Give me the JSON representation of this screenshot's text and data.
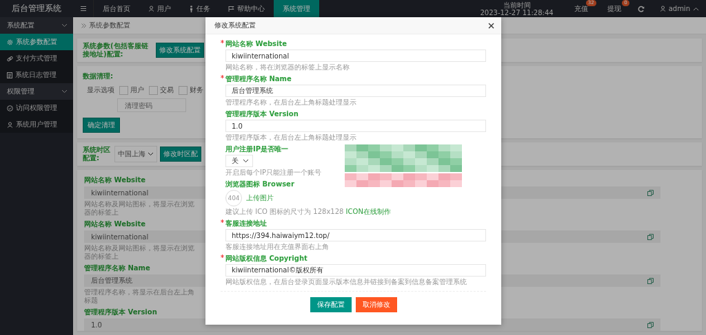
{
  "app_title": "后台管理系统",
  "topnav": [
    {
      "label": "后台首页",
      "selected": false
    },
    {
      "label": "用户",
      "selected": false
    },
    {
      "label": "任务",
      "selected": false
    },
    {
      "label": "帮助中心",
      "selected": false
    },
    {
      "label": "系统管理",
      "selected": true
    }
  ],
  "clock": {
    "label": "当前时间",
    "time": "2023-12-27 11:28:44"
  },
  "notifications": [
    {
      "label": "充值",
      "count": "32"
    },
    {
      "label": "提现",
      "count": "0"
    }
  ],
  "user": {
    "name": "admin"
  },
  "sidebar": [
    {
      "label": "系统配置",
      "expanded": true,
      "items": [
        {
          "label": "系统参数配置",
          "selected": true
        },
        {
          "label": "支付方式管理",
          "selected": false
        },
        {
          "label": "系统日志管理",
          "selected": false
        }
      ]
    },
    {
      "label": "权限管理",
      "expanded": true,
      "items": [
        {
          "label": "访问权限管理",
          "selected": false
        },
        {
          "label": "系统用户管理",
          "selected": false
        }
      ]
    }
  ],
  "breadcrumb": "系统参数配置",
  "param_card": {
    "label": "系统参数(包括客服链接地址)配置:",
    "button": "修改系统配置"
  },
  "cleanup_card": {
    "title": "数据清理:",
    "options_label": "显示选项",
    "options": [
      {
        "label": "用户",
        "checked": false
      },
      {
        "label": "交易",
        "checked": false
      },
      {
        "label": "财务",
        "checked": false
      }
    ],
    "password_placeholder": "清理密码",
    "button": "确定清理"
  },
  "timezone_card": {
    "label": "系统时区配置:",
    "value": "中国上海",
    "button": "修改时区配"
  },
  "settings_list": [
    {
      "label": "网站名称 Website",
      "value": "kiwiinternational",
      "help": "网站名称及网站图标，将显示在浏览器的标签上"
    },
    {
      "label": "网站名称 Website",
      "value": "kiwiinternational",
      "help": "网站名称及网站图标，将显示在浏览器的标签上"
    },
    {
      "label": "管理程序名称 Name",
      "value": "后台管理系统",
      "help": "管理程序名称，将显示在后台左上角标题"
    },
    {
      "label": "管理程序版本 Version",
      "value": "1.0"
    }
  ],
  "modal": {
    "title": "修改系统配置",
    "fields": [
      {
        "kind": "text",
        "required": true,
        "label": "网站名称 Website",
        "value": "kiwiinternational",
        "help": "网站名称，将在浏览器的标签上显示名称"
      },
      {
        "kind": "text",
        "required": true,
        "label": "管理程序名称 Name",
        "value": "后台管理系统",
        "help": "管理程序名称，在后台左上角标题处理显示"
      },
      {
        "kind": "text",
        "required": false,
        "label": "管理程序版本 Version",
        "value": "1.0",
        "help": "管理程序版本，在后台左上角标题处理显示"
      },
      {
        "kind": "select",
        "required": false,
        "label": "用户注册IP是否唯一",
        "value": "关",
        "help": "开启后每个IP只能注册一个账号"
      },
      {
        "kind": "image",
        "required": false,
        "label": "浏览器图标 Browser",
        "image_text": "404",
        "upload": "上传图片",
        "help": "建议上传 ICO 图标的尺寸为 128x128 ",
        "help_link": "ICON在线制作"
      },
      {
        "kind": "text",
        "required": true,
        "label": "客服连接地址",
        "value": "https://394.haiwaiym12.top/",
        "help": "客服连接地址用在充值界面右上角"
      },
      {
        "kind": "text",
        "required": true,
        "label": "网站版权信息 Copyright",
        "value": "kiwiinternational©版权所有",
        "help": "网站版权信息，在后台登录页面显示版本信息并链接到备案到信息备案管理系统"
      }
    ],
    "buttons": [
      {
        "label": "保存配置",
        "kind": "primary"
      },
      {
        "label": "取消修改",
        "kind": "danger"
      }
    ]
  }
}
